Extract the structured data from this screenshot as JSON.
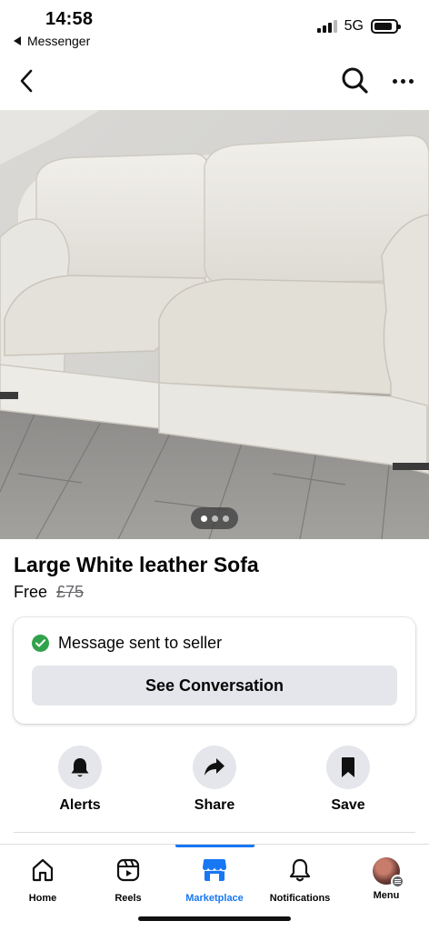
{
  "status_bar": {
    "time": "14:58",
    "back_app": "Messenger",
    "network": "5G",
    "signal_bars": 3
  },
  "top_nav": {
    "back_icon": "chevron-left-icon",
    "search_icon": "search-icon",
    "more_icon": "more-horizontal-icon"
  },
  "photo": {
    "description_icon": "listing-photo",
    "pager_count": 3,
    "pager_active": 0
  },
  "listing": {
    "title": "Large White leather Sofa",
    "price": "Free",
    "original_price": "£75"
  },
  "message_card": {
    "status_text": "Message sent to seller",
    "button_label": "See Conversation",
    "status_color": "#31a24c"
  },
  "actions": [
    {
      "label": "Alerts",
      "icon": "bell-icon"
    },
    {
      "label": "Share",
      "icon": "share-arrow-icon"
    },
    {
      "label": "Save",
      "icon": "bookmark-icon"
    }
  ],
  "tab_bar": {
    "accent": "#1877f2",
    "tabs": [
      {
        "label": "Home",
        "icon": "home-icon"
      },
      {
        "label": "Reels",
        "icon": "reels-icon"
      },
      {
        "label": "Marketplace",
        "icon": "marketplace-icon",
        "active": true
      },
      {
        "label": "Notifications",
        "icon": "bell-icon"
      },
      {
        "label": "Menu",
        "icon": "avatar"
      }
    ]
  }
}
